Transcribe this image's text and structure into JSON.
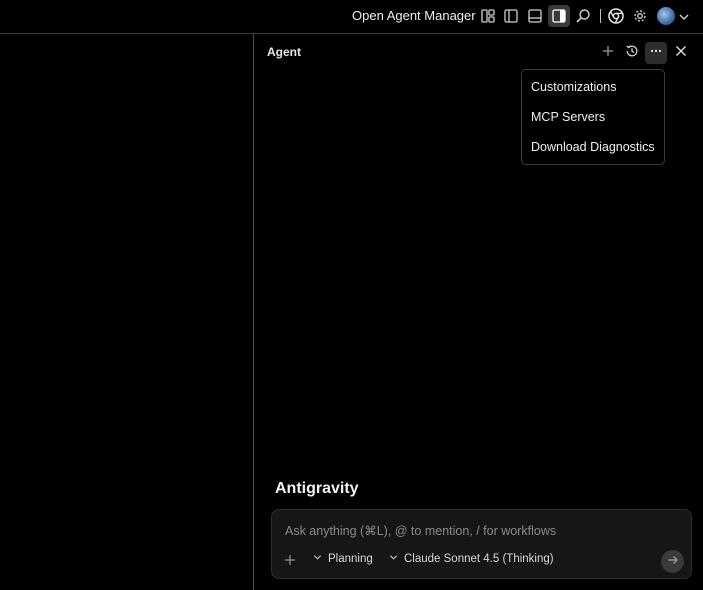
{
  "topbar": {
    "open_agent_manager": "Open Agent Manager",
    "icons": [
      "layout-icon",
      "sidebar-left-icon",
      "panel-bottom-icon",
      "sidebar-right-icon",
      "search-icon",
      "chrome-icon",
      "gear-icon",
      "avatar",
      "chevron-down-icon"
    ]
  },
  "agent": {
    "title": "Agent",
    "icons": [
      "plus-icon",
      "history-icon",
      "more-icon",
      "close-icon"
    ]
  },
  "menu": {
    "items": [
      "Customizations",
      "MCP Servers",
      "Download Diagnostics"
    ]
  },
  "brand": "Antigravity",
  "composer": {
    "placeholder": "Ask anything (⌘L), @ to mention, / for workflows",
    "mode": "Planning",
    "model": "Claude Sonnet 4.5 (Thinking)"
  },
  "colors": {
    "background": "#000000",
    "divider": "#4a5060",
    "composer_bg": "#161616"
  }
}
